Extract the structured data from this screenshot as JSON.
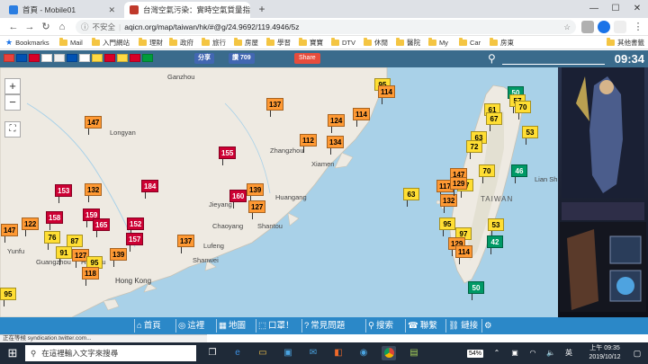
{
  "browser": {
    "tabs": [
      {
        "title": "首頁 - Mobile01",
        "active": false
      },
      {
        "title": "台灣空氣污染：實時空氣質量指數",
        "active": true
      }
    ],
    "omnibox": {
      "security": "不安全",
      "url": "aqicn.org/map/taiwan/hk/#@g/24.9692/119.4946/5z"
    },
    "bookmarks": [
      {
        "label": "Bookmarks"
      },
      {
        "label": "Mail"
      },
      {
        "label": "入門網站"
      },
      {
        "label": "理財"
      },
      {
        "label": "政府"
      },
      {
        "label": "旅行"
      },
      {
        "label": "房屋"
      },
      {
        "label": "學習"
      },
      {
        "label": "寶寶"
      },
      {
        "label": "DTV"
      },
      {
        "label": "休閒"
      },
      {
        "label": "醫院"
      },
      {
        "label": "My"
      },
      {
        "label": "Car"
      },
      {
        "label": "房東"
      }
    ],
    "other_bookmarks": "其他書籤"
  },
  "sitebar": {
    "flags": [
      "#e8423b",
      "#0052b4",
      "#d80027",
      "#ffffff",
      "#eeeeee",
      "#0052b4",
      "#ffffff",
      "#ffda44",
      "#d80027",
      "#ffda44",
      "#d80027",
      "#009c3b"
    ],
    "fb_share": "分享",
    "fb_like": "讚 709",
    "share": "Share",
    "time": "09:34"
  },
  "map": {
    "zoom_in": "+",
    "zoom_out": "−",
    "cities": [
      {
        "name": "Ganzhou"
      },
      {
        "name": "Longyan"
      },
      {
        "name": "Zhangzhou"
      },
      {
        "name": "Xiamen"
      },
      {
        "name": "Huangang"
      },
      {
        "name": "Jieyang"
      },
      {
        "name": "Chaoyang"
      },
      {
        "name": "Shantou"
      },
      {
        "name": "Lufeng"
      },
      {
        "name": "Shanwei"
      },
      {
        "name": "Yunfu"
      },
      {
        "name": "Hong Kong"
      },
      {
        "name": "TAIWAN"
      },
      {
        "name": "Lian Sh"
      },
      {
        "name": "Huizhou"
      },
      {
        "name": "Guangzhou"
      }
    ],
    "markers": [
      {
        "value": "95",
        "level": "mod"
      },
      {
        "value": "114",
        "level": "usg"
      },
      {
        "value": "147",
        "level": "usg"
      },
      {
        "value": "137",
        "level": "usg"
      },
      {
        "value": "124",
        "level": "usg"
      },
      {
        "value": "114",
        "level": "usg"
      },
      {
        "value": "112",
        "level": "usg"
      },
      {
        "value": "134",
        "level": "usg"
      },
      {
        "value": "155",
        "level": "unh"
      },
      {
        "value": "184",
        "level": "unh"
      },
      {
        "value": "153",
        "level": "unh"
      },
      {
        "value": "132",
        "level": "usg"
      },
      {
        "value": "160",
        "level": "unh"
      },
      {
        "value": "139",
        "level": "usg"
      },
      {
        "value": "127",
        "level": "usg"
      },
      {
        "value": "158",
        "level": "unh"
      },
      {
        "value": "159",
        "level": "unh"
      },
      {
        "value": "152",
        "level": "unh"
      },
      {
        "value": "165",
        "level": "unh"
      },
      {
        "value": "157",
        "level": "unh"
      },
      {
        "value": "122",
        "level": "usg"
      },
      {
        "value": "147",
        "level": "usg"
      },
      {
        "value": "76",
        "level": "mod"
      },
      {
        "value": "87",
        "level": "mod"
      },
      {
        "value": "91",
        "level": "mod"
      },
      {
        "value": "127",
        "level": "usg"
      },
      {
        "value": "139",
        "level": "usg"
      },
      {
        "value": "95",
        "level": "mod"
      },
      {
        "value": "118",
        "level": "usg"
      },
      {
        "value": "137",
        "level": "usg"
      },
      {
        "value": "95",
        "level": "mod"
      },
      {
        "value": "63",
        "level": "mod"
      },
      {
        "value": "50",
        "level": "good"
      },
      {
        "value": "57",
        "level": "mod"
      },
      {
        "value": "61",
        "level": "mod"
      },
      {
        "value": "67",
        "level": "mod"
      },
      {
        "value": "70",
        "level": "mod"
      },
      {
        "value": "53",
        "level": "mod"
      },
      {
        "value": "63",
        "level": "mod"
      },
      {
        "value": "72",
        "level": "mod"
      },
      {
        "value": "147",
        "level": "usg"
      },
      {
        "value": "70",
        "level": "mod"
      },
      {
        "value": "46",
        "level": "good"
      },
      {
        "value": "117",
        "level": "usg"
      },
      {
        "value": "97",
        "level": "mod"
      },
      {
        "value": "132",
        "level": "usg"
      },
      {
        "value": "95",
        "level": "mod"
      },
      {
        "value": "97",
        "level": "mod"
      },
      {
        "value": "53",
        "level": "mod"
      },
      {
        "value": "129",
        "level": "usg"
      },
      {
        "value": "42",
        "level": "good"
      },
      {
        "value": "50",
        "level": "good"
      },
      {
        "value": "129",
        "level": "usg"
      },
      {
        "value": "114",
        "level": "usg"
      }
    ]
  },
  "bottomnav": [
    {
      "icon": "home-icon",
      "label": "首頁"
    },
    {
      "icon": "location-icon",
      "label": "這裡"
    },
    {
      "icon": "map-icon",
      "label": "地圖"
    },
    {
      "icon": "mask-icon",
      "label": "口罩！"
    },
    {
      "icon": "help-icon",
      "label": "常見問題"
    },
    {
      "icon": "search-icon",
      "label": "搜索"
    },
    {
      "icon": "contact-icon",
      "label": "聯繫"
    },
    {
      "icon": "link-icon",
      "label": "鏈接"
    },
    {
      "icon": "settings-icon",
      "label": ""
    }
  ],
  "status_text": "正在等候 syndication.twitter.com...",
  "taskbar": {
    "search_placeholder": "在這裡輸入文字來搜尋",
    "battery": "54%",
    "clock_time": "上午 09:35",
    "clock_date": "2019/10/12"
  },
  "colors": {
    "good": "#009966",
    "moderate": "#ffde33",
    "usg": "#ff9933",
    "unhealthy": "#cc0033",
    "sitebar": "#3a6b8c",
    "bottomnav": "#2b88c8",
    "taskbar": "#1f2a38"
  }
}
